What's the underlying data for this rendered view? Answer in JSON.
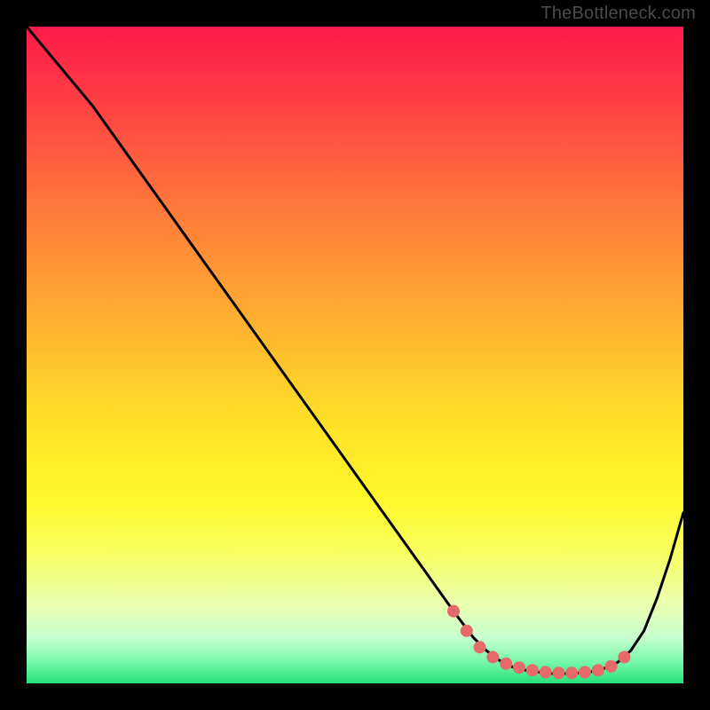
{
  "attribution": "TheBottleneck.com",
  "colors": {
    "background": "#000000",
    "gradient_top": "#ff1a4b",
    "gradient_bottom": "#25e07a",
    "curve": "#000000",
    "marker": "#e66a6a"
  },
  "chart_data": {
    "type": "line",
    "title": "",
    "xlabel": "",
    "ylabel": "",
    "xlim": [
      0,
      100
    ],
    "ylim": [
      0,
      100
    ],
    "grid": false,
    "legend": false,
    "series": [
      {
        "name": "bottleneck-curve",
        "x": [
          0,
          5,
          10,
          15,
          20,
          25,
          30,
          35,
          40,
          45,
          50,
          55,
          60,
          65,
          68,
          70,
          72,
          74,
          76,
          78,
          80,
          82,
          84,
          86,
          88,
          90,
          92,
          94,
          96,
          98,
          100
        ],
        "values": [
          100,
          94,
          88,
          81,
          74,
          67,
          60,
          53,
          46,
          39,
          32,
          25,
          18,
          11,
          7,
          5,
          3.5,
          2.5,
          2,
          1.7,
          1.5,
          1.5,
          1.6,
          1.8,
          2.3,
          3.2,
          5,
          8,
          13,
          19,
          26
        ]
      }
    ],
    "markers": {
      "name": "highlight-points",
      "x": [
        65,
        67,
        69,
        71,
        73,
        75,
        77,
        79,
        81,
        83,
        85,
        87,
        89,
        91
      ],
      "values": [
        11,
        8,
        5.5,
        4,
        3,
        2.4,
        2,
        1.7,
        1.6,
        1.6,
        1.7,
        2,
        2.6,
        4
      ]
    }
  }
}
